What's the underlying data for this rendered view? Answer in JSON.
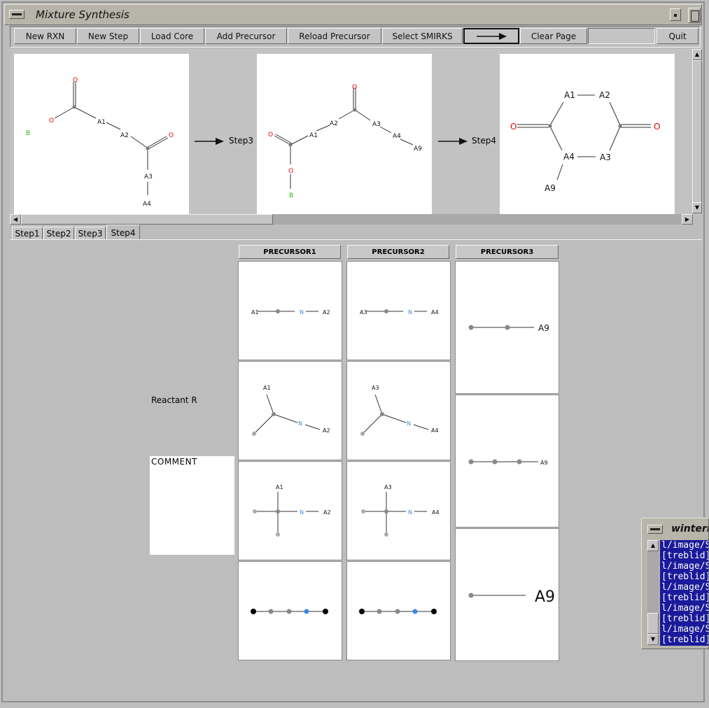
{
  "window": {
    "title": "Mixture Synthesis"
  },
  "toolbar": {
    "buttons": [
      "New RXN",
      "New Step",
      "Load Core",
      "Add Precursor",
      "Reload Precursor",
      "Select SMIRKS",
      "Clear Page",
      "Quit"
    ]
  },
  "reaction": {
    "steps": [
      {
        "label": "Step3"
      },
      {
        "label": "Step4"
      }
    ],
    "molecules": [
      {
        "atoms": [
          "O",
          "B",
          "O",
          "A1",
          "A2",
          "O",
          "A3",
          "A4"
        ]
      },
      {
        "atoms": [
          "O",
          "A2",
          "A3",
          "A4",
          "A9",
          "O",
          "A1",
          "O",
          "B"
        ]
      },
      {
        "atoms": [
          "A1",
          "A2",
          "O",
          "O",
          "A4",
          "A3",
          "A9"
        ]
      }
    ]
  },
  "tabs": [
    "Step1",
    "Step2",
    "Step3",
    "Step4"
  ],
  "selected_tab": "Step4",
  "precursors": {
    "headers": [
      "PRECURSOR1",
      "PRECURSOR2",
      "PRECURSOR3"
    ],
    "p1_labels": [
      "A1",
      "N",
      "A2"
    ],
    "p2_labels": [
      "A3",
      "N",
      "A4"
    ],
    "p3_labels": [
      "A9"
    ]
  },
  "reactant_label": "Reactant R",
  "comment_label": "COMMENT",
  "winterm": {
    "title": "winterm",
    "lines": [
      "l/image/S",
      "[treblid]",
      "l/image/S",
      "[treblid]",
      "l/image/S",
      "[treblid]",
      "l/image/S",
      "[treblid]",
      "l/image/S",
      "[treblid]"
    ]
  },
  "colors": {
    "oxygen": "#e00000",
    "boron": "#22bb00",
    "nitrogen": "#3a8adf",
    "terminal_bg": "#1a1a9a"
  }
}
